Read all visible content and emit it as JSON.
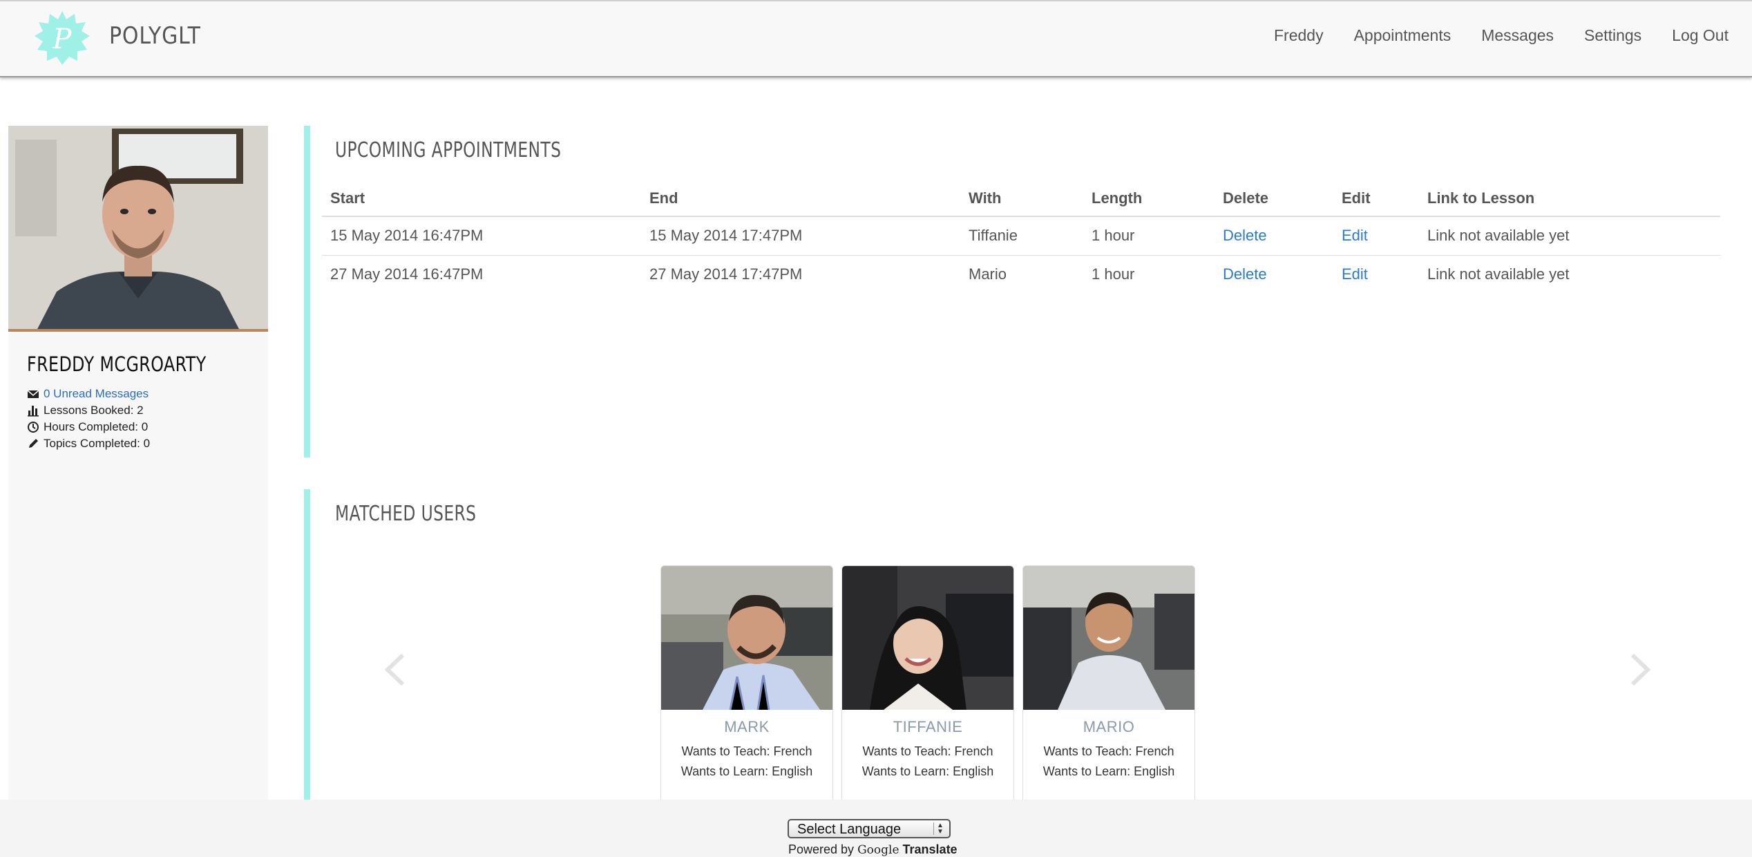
{
  "brand": {
    "name": "POLYGLT",
    "logo_letter": "P",
    "accent": "#9ff0e6"
  },
  "nav": {
    "items": [
      "Freddy",
      "Appointments",
      "Messages",
      "Settings",
      "Log Out"
    ]
  },
  "profile": {
    "name": "FREDDY MCGROARTY",
    "unread_messages": "0 Unread Messages",
    "lessons_booked": "Lessons Booked: 2",
    "hours_completed": "Hours Completed: 0",
    "topics_completed": "Topics Completed: 0"
  },
  "appointments": {
    "title": "UPCOMING APPOINTMENTS",
    "columns": [
      "Start",
      "End",
      "With",
      "Length",
      "Delete",
      "Edit",
      "Link to Lesson"
    ],
    "rows": [
      {
        "start": "15 May 2014 16:47PM",
        "end": "15 May 2014 17:47PM",
        "with": "Tiffanie",
        "length": "1 hour",
        "delete": "Delete",
        "edit": "Edit",
        "link": "Link not available yet"
      },
      {
        "start": "27 May 2014 16:47PM",
        "end": "27 May 2014 17:47PM",
        "with": "Mario",
        "length": "1 hour",
        "delete": "Delete",
        "edit": "Edit",
        "link": "Link not available yet"
      }
    ]
  },
  "matched": {
    "title": "MATCHED USERS",
    "users": [
      {
        "name": "MARK",
        "teach": "Wants to Teach: French",
        "learn": "Wants to Learn: English"
      },
      {
        "name": "TIFFANIE",
        "teach": "Wants to Teach: French",
        "learn": "Wants to Learn: English"
      },
      {
        "name": "MARIO",
        "teach": "Wants to Teach: French",
        "learn": "Wants to Learn: English"
      }
    ]
  },
  "footer": {
    "select_language": "Select Language",
    "powered_by": "Powered by",
    "google": "Google",
    "translate": "Translate"
  }
}
